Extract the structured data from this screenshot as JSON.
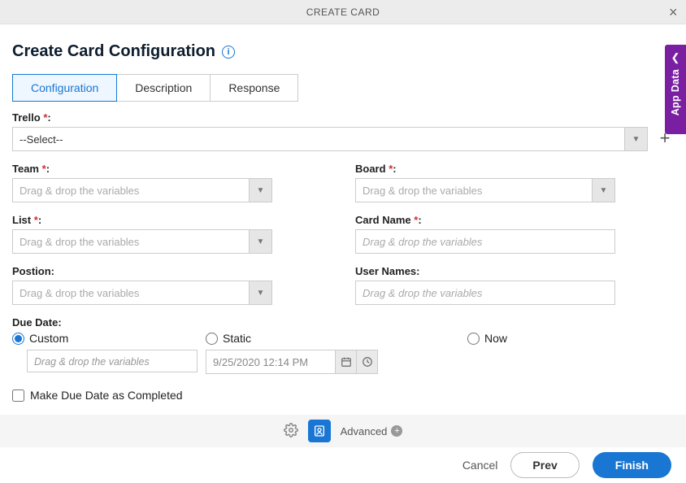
{
  "header": {
    "title": "CREATE CARD"
  },
  "page": {
    "title": "Create Card Configuration"
  },
  "tabs": [
    {
      "label": "Configuration"
    },
    {
      "label": "Description"
    },
    {
      "label": "Response"
    }
  ],
  "fields": {
    "trello": {
      "label": "Trello",
      "selected": "--Select--"
    },
    "team": {
      "label": "Team",
      "placeholder": "Drag & drop the variables"
    },
    "board": {
      "label": "Board",
      "placeholder": "Drag & drop the variables"
    },
    "list": {
      "label": "List",
      "placeholder": "Drag & drop the variables"
    },
    "cardname": {
      "label": "Card Name",
      "placeholder": "Drag & drop the variables"
    },
    "position": {
      "label": "Postion:",
      "placeholder": "Drag & drop the variables"
    },
    "usernames": {
      "label": "User Names:",
      "placeholder": "Drag & drop the variables"
    }
  },
  "duedate": {
    "label": "Due Date:",
    "custom": {
      "label": "Custom",
      "placeholder": "Drag & drop the variables"
    },
    "staticr": {
      "label": "Static",
      "value": "9/25/2020 12:14 PM"
    },
    "now": {
      "label": "Now"
    },
    "checkbox": {
      "label": "Make Due Date as Completed"
    }
  },
  "advanced": {
    "label": "Advanced"
  },
  "footer": {
    "cancel": "Cancel",
    "prev": "Prev",
    "finish": "Finish"
  },
  "sideTab": {
    "label": "App Data"
  }
}
